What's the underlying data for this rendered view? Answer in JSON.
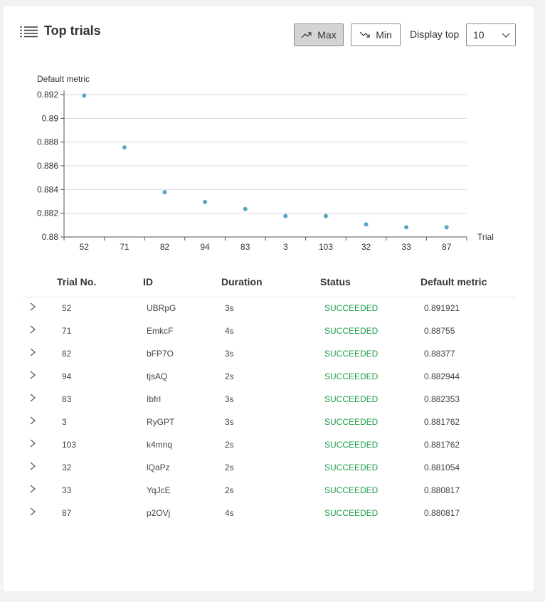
{
  "header": {
    "title": "Top trials",
    "max_label": "Max",
    "min_label": "Min",
    "display_top_label": "Display top",
    "display_top_value": "10",
    "icons": {
      "title": "list-icon",
      "max": "trend-up-icon",
      "min": "trend-down-icon",
      "select": "chevron-down-icon"
    }
  },
  "chart_data": {
    "type": "scatter",
    "ylabel": "Default metric",
    "xlabel": "Trial",
    "categories": [
      "52",
      "71",
      "82",
      "94",
      "83",
      "3",
      "103",
      "32",
      "33",
      "87"
    ],
    "values": [
      0.891921,
      0.88755,
      0.88377,
      0.882944,
      0.882353,
      0.881762,
      0.881762,
      0.881054,
      0.880817,
      0.880817
    ],
    "ylim": [
      0.88,
      0.892
    ],
    "yticks": [
      0.892,
      0.89,
      0.888,
      0.886,
      0.884,
      0.882,
      0.88
    ],
    "ytick_labels": [
      "0.892",
      "0.89",
      "0.888",
      "0.886",
      "0.884",
      "0.882",
      "0.88"
    ],
    "grid": true,
    "point_color": "#5ba3c7"
  },
  "table": {
    "columns": [
      "Trial No.",
      "ID",
      "Duration",
      "Status",
      "Default metric"
    ],
    "status_color": "#1e9e4a",
    "rows": [
      {
        "trial": "52",
        "id": "UBRpG",
        "duration": "3s",
        "status": "SUCCEEDED",
        "metric": "0.891921"
      },
      {
        "trial": "71",
        "id": "EmkcF",
        "duration": "4s",
        "status": "SUCCEEDED",
        "metric": "0.88755"
      },
      {
        "trial": "82",
        "id": "bFP7O",
        "duration": "3s",
        "status": "SUCCEEDED",
        "metric": "0.88377"
      },
      {
        "trial": "94",
        "id": "tjsAQ",
        "duration": "2s",
        "status": "SUCCEEDED",
        "metric": "0.882944"
      },
      {
        "trial": "83",
        "id": "Ibfrl",
        "duration": "3s",
        "status": "SUCCEEDED",
        "metric": "0.882353"
      },
      {
        "trial": "3",
        "id": "RyGPT",
        "duration": "3s",
        "status": "SUCCEEDED",
        "metric": "0.881762"
      },
      {
        "trial": "103",
        "id": "k4mnq",
        "duration": "2s",
        "status": "SUCCEEDED",
        "metric": "0.881762"
      },
      {
        "trial": "32",
        "id": "lQaPz",
        "duration": "2s",
        "status": "SUCCEEDED",
        "metric": "0.881054"
      },
      {
        "trial": "33",
        "id": "YqJcE",
        "duration": "2s",
        "status": "SUCCEEDED",
        "metric": "0.880817"
      },
      {
        "trial": "87",
        "id": "p2OVj",
        "duration": "4s",
        "status": "SUCCEEDED",
        "metric": "0.880817"
      }
    ]
  }
}
